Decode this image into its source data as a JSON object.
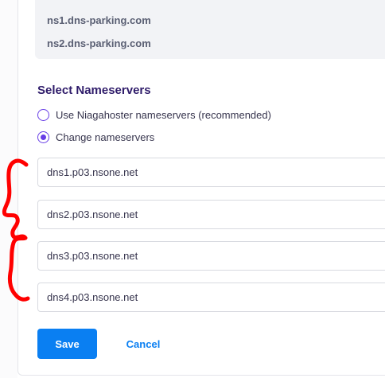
{
  "current_nameservers": [
    "ns1.dns-parking.com",
    "ns2.dns-parking.com"
  ],
  "section_title": "Select Nameservers",
  "options": [
    {
      "label": "Use Niagahoster nameservers (recommended)",
      "selected": false
    },
    {
      "label": "Change nameservers",
      "selected": true
    }
  ],
  "nameserver_inputs": [
    "dns1.p03.nsone.net",
    "dns2.p03.nsone.net",
    "dns3.p03.nsone.net",
    "dns4.p03.nsone.net"
  ],
  "actions": {
    "save_label": "Save",
    "cancel_label": "Cancel"
  },
  "colors": {
    "accent": "#673de6",
    "primary_button": "#0a7ff2",
    "annotation": "#ff0000"
  }
}
